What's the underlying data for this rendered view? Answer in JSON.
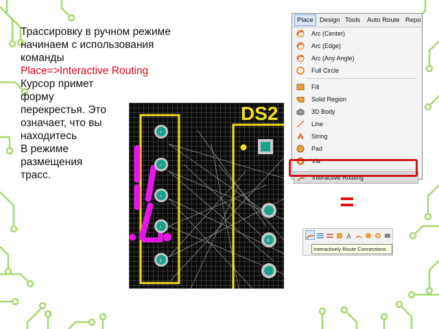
{
  "slide": {
    "lines": [
      "Трассировку в ручном режиме",
      "начинаем с использования",
      "команды",
      "Place=>Interactive Routing",
      "Курсор примет",
      "форму",
      "перекрестья. Это",
      "означает, что вы",
      "находитесь",
      "В режиме",
      "размещения",
      "трасс."
    ]
  },
  "pcb": {
    "component_label": "DS2",
    "pad_labels": [
      "5",
      "4",
      "3",
      "2",
      "1",
      "6"
    ],
    "colors": {
      "trace": "#e617e6",
      "outline": "#f0e020",
      "pad": "#c8c8c8",
      "board": "#0b0b0b"
    }
  },
  "menu": {
    "menubar": [
      "Place",
      "Design",
      "Tools",
      "Auto Route",
      "Repo"
    ],
    "items": [
      {
        "label": "Arc (Center)",
        "icon": "arc-center-icon"
      },
      {
        "label": "Arc (Edge)",
        "icon": "arc-edge-icon"
      },
      {
        "label": "Arc (Any Angle)",
        "icon": "arc-any-angle-icon"
      },
      {
        "label": "Full Circle",
        "icon": "full-circle-icon"
      },
      {
        "label": "Fill",
        "icon": "fill-icon"
      },
      {
        "label": "Solid Region",
        "icon": "solid-region-icon"
      },
      {
        "label": "3D Body",
        "icon": "3d-body-icon"
      },
      {
        "label": "Line",
        "icon": "line-icon"
      },
      {
        "label": "String",
        "icon": "string-icon"
      },
      {
        "label": "Pad",
        "icon": "pad-icon"
      },
      {
        "label": "Via",
        "icon": "via-icon"
      },
      {
        "label": "Interactive Routing",
        "icon": "interactive-routing-icon"
      }
    ]
  },
  "equals_sign": "=",
  "toolbar": {
    "tooltip": "Interactively Route Connections",
    "buttons": [
      "interactive-routing-icon",
      "multi-route-icon",
      "diff-pair-icon",
      "fill-icon",
      "string-icon",
      "arc-icon",
      "pad-icon",
      "via-icon",
      "component-icon",
      "region-icon"
    ]
  }
}
